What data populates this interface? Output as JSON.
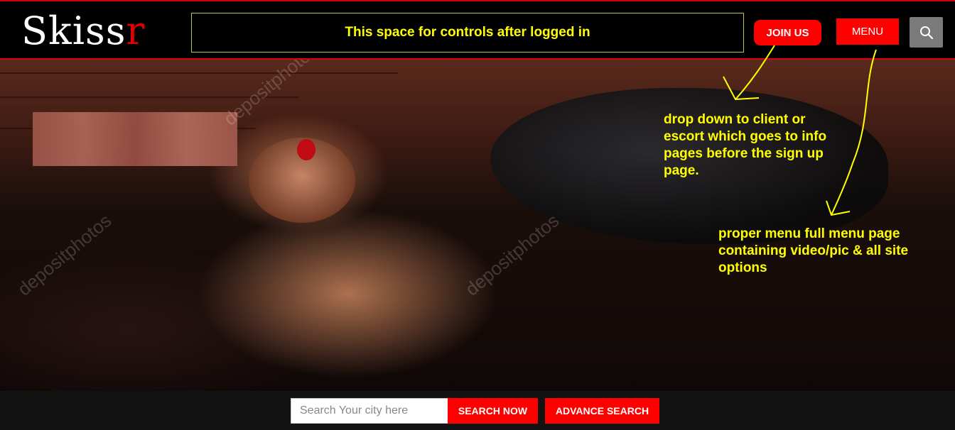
{
  "brand": {
    "logo_main": "Skiss",
    "logo_accent": "r",
    "accent_color": "#ff0000"
  },
  "header": {
    "controls_placeholder": "This space for controls after logged in",
    "join_label": "JOIN US",
    "menu_label": "MENU",
    "search_icon": "search-icon"
  },
  "annotations": {
    "join_note": "drop down to client or escort which goes to info pages before the sign up page.",
    "menu_note": "proper menu full menu page containing video/pic & all site options",
    "color": "#ffff00"
  },
  "hero": {
    "watermark": "depositphotos"
  },
  "search": {
    "placeholder": "Search Your city here",
    "search_now_label": "SEARCH NOW",
    "advance_search_label": "ADVANCE SEARCH"
  }
}
